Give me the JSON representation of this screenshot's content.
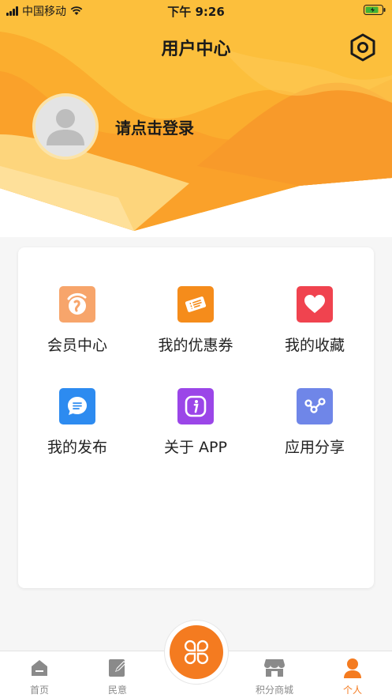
{
  "status_bar": {
    "carrier": "中国移动",
    "time": "下午 9:26"
  },
  "header": {
    "title": "用户中心"
  },
  "profile": {
    "login_prompt": "请点击登录"
  },
  "menu": {
    "items": [
      {
        "label": "会员中心",
        "icon": "member-icon",
        "color": "#f7a56b"
      },
      {
        "label": "我的优惠券",
        "icon": "coupon-icon",
        "color": "#f58c1b"
      },
      {
        "label": "我的收藏",
        "icon": "heart-icon",
        "color": "#f0434f"
      },
      {
        "label": "我的发布",
        "icon": "message-icon",
        "color": "#2d8bf0"
      },
      {
        "label": "关于 APP",
        "icon": "info-icon",
        "color": "#9b46e8"
      },
      {
        "label": "应用分享",
        "icon": "share-icon",
        "color": "#6f86e8"
      }
    ]
  },
  "tabbar": {
    "tabs": [
      {
        "label": "首页",
        "icon": "home-icon"
      },
      {
        "label": "民意",
        "icon": "edit-icon"
      },
      {
        "label": "积分商城",
        "icon": "store-icon"
      },
      {
        "label": "个人",
        "icon": "person-icon",
        "active": true
      }
    ],
    "center_icon": "clover-icon"
  },
  "colors": {
    "accent": "#f47b20",
    "hero_yellow": "#fbb83a",
    "inactive_tab": "#8a8a8a"
  }
}
